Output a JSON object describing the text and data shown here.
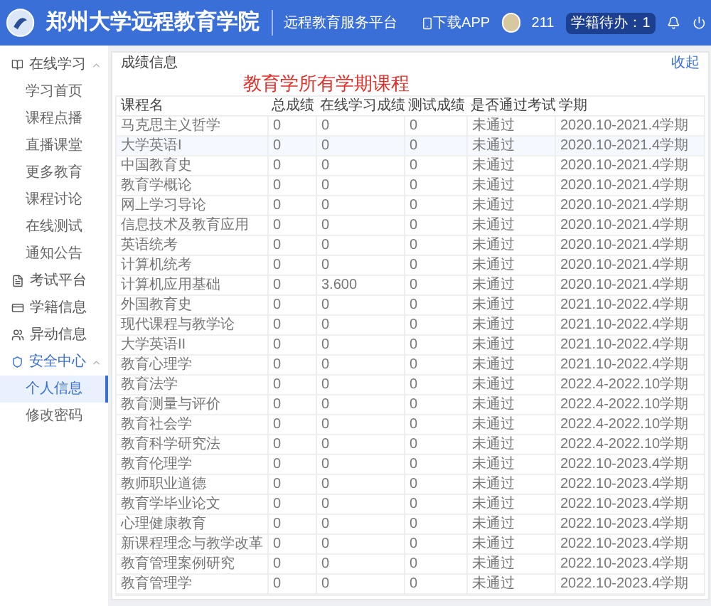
{
  "header": {
    "school": "郑州大学远程教育学院",
    "platform": "远程教育服务平台",
    "download": "下载APP",
    "user": "211",
    "badge": "学籍待办：1"
  },
  "sidebar": {
    "groups": [
      {
        "label": "在线学习",
        "expanded": true,
        "selected": false,
        "children": [
          {
            "label": "学习首页",
            "selected": false
          },
          {
            "label": "课程点播",
            "selected": false
          },
          {
            "label": "直播课堂",
            "selected": false
          },
          {
            "label": "更多教育",
            "selected": false
          },
          {
            "label": "课程讨论",
            "selected": false
          },
          {
            "label": "在线测试",
            "selected": false
          },
          {
            "label": "通知公告",
            "selected": false
          }
        ]
      },
      {
        "label": "考试平台",
        "selected": false
      },
      {
        "label": "学籍信息",
        "selected": false
      },
      {
        "label": "异动信息",
        "selected": false
      },
      {
        "label": "安全中心",
        "expanded": true,
        "selected": true,
        "children": [
          {
            "label": "个人信息",
            "selected": true
          },
          {
            "label": "修改密码",
            "selected": false
          }
        ]
      }
    ]
  },
  "panel": {
    "title": "成绩信息",
    "overlay_title": "教育学所有学期课程",
    "collapse": "收起"
  },
  "table": {
    "columns": [
      "课程名",
      "总成绩",
      "在线学习成绩",
      "测试成绩",
      "是否通过考试",
      "学期"
    ],
    "rows": [
      [
        "马克思主义哲学",
        "0",
        "0",
        "0",
        "未通过",
        "2020.10-2021.4学期"
      ],
      [
        "大学英语I",
        "0",
        "0",
        "0",
        "未通过",
        "2020.10-2021.4学期"
      ],
      [
        "中国教育史",
        "0",
        "0",
        "0",
        "未通过",
        "2020.10-2021.4学期"
      ],
      [
        "教育学概论",
        "0",
        "0",
        "0",
        "未通过",
        "2020.10-2021.4学期"
      ],
      [
        "网上学习导论",
        "0",
        "0",
        "0",
        "未通过",
        "2020.10-2021.4学期"
      ],
      [
        "信息技术及教育应用",
        "0",
        "0",
        "0",
        "未通过",
        "2020.10-2021.4学期"
      ],
      [
        "英语统考",
        "0",
        "0",
        "0",
        "未通过",
        "2020.10-2021.4学期"
      ],
      [
        "计算机统考",
        "0",
        "0",
        "0",
        "未通过",
        "2020.10-2021.4学期"
      ],
      [
        "计算机应用基础",
        "0",
        "3.600",
        "0",
        "未通过",
        "2020.10-2021.4学期"
      ],
      [
        "外国教育史",
        "0",
        "0",
        "0",
        "未通过",
        "2021.10-2022.4学期"
      ],
      [
        "现代课程与教学论",
        "0",
        "0",
        "0",
        "未通过",
        "2021.10-2022.4学期"
      ],
      [
        "大学英语II",
        "0",
        "0",
        "0",
        "未通过",
        "2021.10-2022.4学期"
      ],
      [
        "教育心理学",
        "0",
        "0",
        "0",
        "未通过",
        "2021.10-2022.4学期"
      ],
      [
        "教育法学",
        "0",
        "0",
        "0",
        "未通过",
        "2022.4-2022.10学期"
      ],
      [
        "教育测量与评价",
        "0",
        "0",
        "0",
        "未通过",
        "2022.4-2022.10学期"
      ],
      [
        "教育社会学",
        "0",
        "0",
        "0",
        "未通过",
        "2022.4-2022.10学期"
      ],
      [
        "教育科学研究法",
        "0",
        "0",
        "0",
        "未通过",
        "2022.4-2022.10学期"
      ],
      [
        "教育伦理学",
        "0",
        "0",
        "0",
        "未通过",
        "2022.10-2023.4学期"
      ],
      [
        "教师职业道德",
        "0",
        "0",
        "0",
        "未通过",
        "2022.10-2023.4学期"
      ],
      [
        "教育学毕业论文",
        "0",
        "0",
        "0",
        "未通过",
        "2022.10-2023.4学期"
      ],
      [
        "心理健康教育",
        "0",
        "0",
        "0",
        "未通过",
        "2022.10-2023.4学期"
      ],
      [
        "新课程理念与教学改革",
        "0",
        "0",
        "0",
        "未通过",
        "2022.10-2023.4学期"
      ],
      [
        "教育管理案例研究",
        "0",
        "0",
        "0",
        "未通过",
        "2022.10-2023.4学期"
      ],
      [
        "教育管理学",
        "0",
        "0",
        "0",
        "未通过",
        "2022.10-2023.4学期"
      ]
    ]
  }
}
